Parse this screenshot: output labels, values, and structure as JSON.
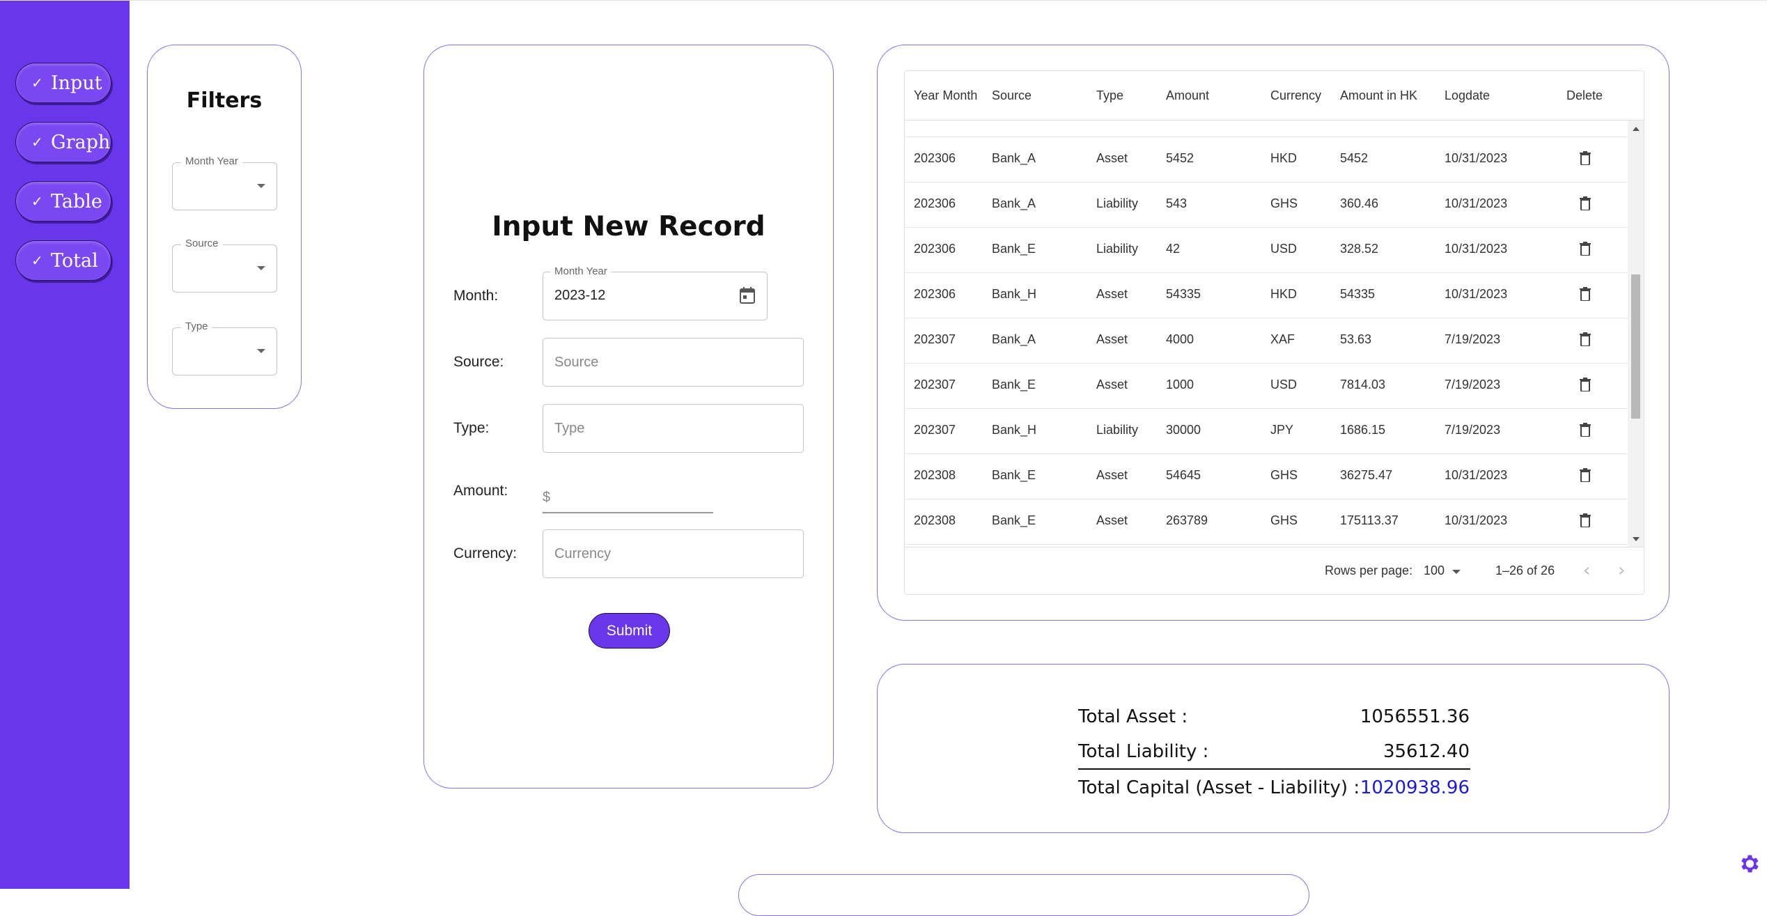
{
  "sidebar": {
    "items": [
      {
        "check": "✓",
        "label": "Input"
      },
      {
        "check": "✓",
        "label": "Graph"
      },
      {
        "check": "✓",
        "label": "Table"
      },
      {
        "check": "✓",
        "label": "Total"
      }
    ]
  },
  "filters": {
    "title": "Filters",
    "month_year_label": "Month Year",
    "source_label": "Source",
    "type_label": "Type"
  },
  "form": {
    "title": "Input New Record",
    "month_label": "Month:",
    "month_field_label": "Month Year",
    "month_value": "2023-12",
    "source_label": "Source:",
    "source_placeholder": "Source",
    "type_label": "Type:",
    "type_placeholder": "Type",
    "amount_label": "Amount:",
    "amount_prefix": "$",
    "currency_label": "Currency:",
    "currency_placeholder": "Currency",
    "submit_label": "Submit"
  },
  "table": {
    "columns": [
      "Year Month",
      "Source",
      "Type",
      "Amount",
      "Currency",
      "Amount in HK",
      "Logdate",
      "Delete"
    ],
    "rows": [
      [
        "202306",
        "Bank_A",
        "Asset",
        "5452",
        "HKD",
        "5452",
        "10/31/2023"
      ],
      [
        "202306",
        "Bank_A",
        "Liability",
        "543",
        "GHS",
        "360.46",
        "10/31/2023"
      ],
      [
        "202306",
        "Bank_E",
        "Liability",
        "42",
        "USD",
        "328.52",
        "10/31/2023"
      ],
      [
        "202306",
        "Bank_H",
        "Asset",
        "54335",
        "HKD",
        "54335",
        "10/31/2023"
      ],
      [
        "202307",
        "Bank_A",
        "Asset",
        "4000",
        "XAF",
        "53.63",
        "7/19/2023"
      ],
      [
        "202307",
        "Bank_E",
        "Asset",
        "1000",
        "USD",
        "7814.03",
        "7/19/2023"
      ],
      [
        "202307",
        "Bank_H",
        "Liability",
        "30000",
        "JPY",
        "1686.15",
        "7/19/2023"
      ],
      [
        "202308",
        "Bank_E",
        "Asset",
        "54645",
        "GHS",
        "36275.47",
        "10/31/2023"
      ],
      [
        "202308",
        "Bank_E",
        "Asset",
        "263789",
        "GHS",
        "175113.37",
        "10/31/2023"
      ]
    ],
    "rows_per_page_label": "Rows per page:",
    "rows_per_page_value": "100",
    "range_text": "1–26 of 26",
    "prev_glyph": "‹",
    "next_glyph": "›"
  },
  "totals": {
    "asset_label": "Total Asset :",
    "asset_value": "1056551.36",
    "liability_label": "Total Liability :",
    "liability_value": "35612.40",
    "capital_label": "Total Capital (Asset - Liability) :",
    "capital_value": "1020938.96",
    "capital_color": "#1a1adf"
  },
  "colors": {
    "sidebar": "#6a36ec",
    "panel_border": "#8b6ff0",
    "accent": "#6a36ec"
  }
}
